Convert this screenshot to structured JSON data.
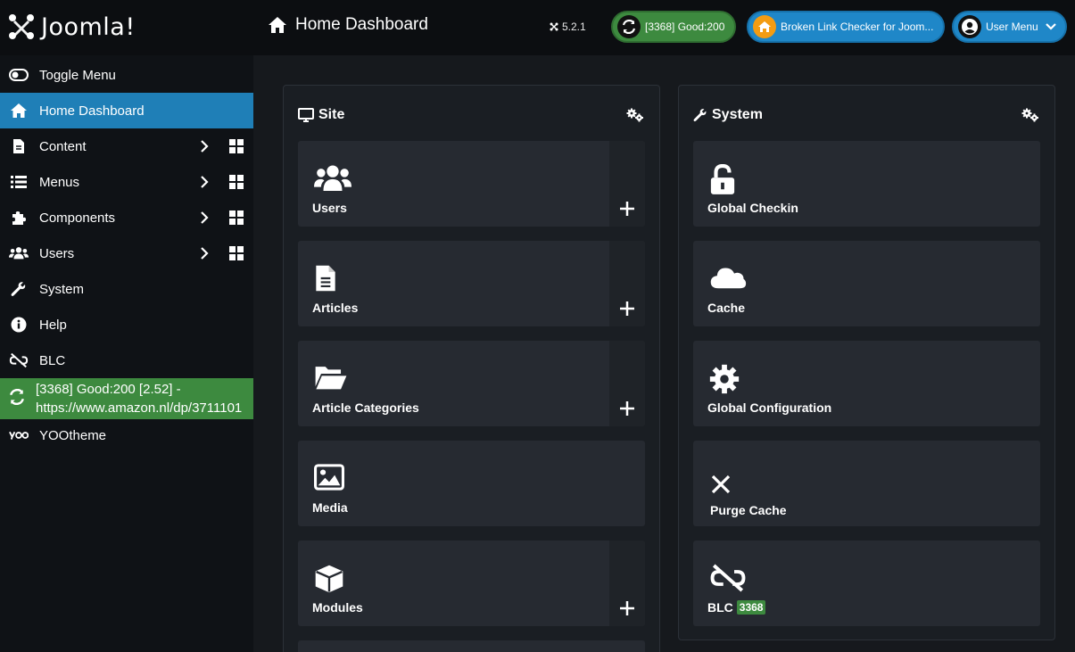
{
  "header": {
    "logo_text": "Joomla!",
    "page_title": "Home Dashboard",
    "version": "5.2.1",
    "blc_status_pill": "[3368] Good:200",
    "blc_plugin_pill": "Broken Link Checker for Joom...",
    "user_menu_label": "User Menu"
  },
  "sidebar": {
    "toggle_label": "Toggle Menu",
    "items": [
      {
        "label": "Home Dashboard",
        "icon": "home-icon",
        "active": true
      },
      {
        "label": "Content",
        "icon": "file-icon"
      },
      {
        "label": "Menus",
        "icon": "list-icon"
      },
      {
        "label": "Components",
        "icon": "puzzle-icon"
      },
      {
        "label": "Users",
        "icon": "users-icon"
      },
      {
        "label": "System",
        "icon": "wrench-icon"
      },
      {
        "label": "Help",
        "icon": "info-icon"
      },
      {
        "label": "BLC",
        "icon": "unlink-icon"
      }
    ],
    "blc_notice_line1": "[3368] Good:200 [2.52] -",
    "blc_notice_line2": "https://www.amazon.nl/dp/3711101",
    "yootheme_label": "YOOtheme"
  },
  "site_panel": {
    "title": "Site",
    "tiles": [
      {
        "label": "Users",
        "icon": "users-icon",
        "has_add": true
      },
      {
        "label": "Articles",
        "icon": "file-icon",
        "has_add": true
      },
      {
        "label": "Article Categories",
        "icon": "folder-open-icon",
        "has_add": true
      },
      {
        "label": "Media",
        "icon": "image-icon",
        "has_add": false
      },
      {
        "label": "Modules",
        "icon": "cube-icon",
        "has_add": true
      }
    ]
  },
  "system_panel": {
    "title": "System",
    "tiles": [
      {
        "label": "Global Checkin",
        "icon": "unlock-icon"
      },
      {
        "label": "Cache",
        "icon": "cloud-icon"
      },
      {
        "label": "Global Configuration",
        "icon": "gear-icon"
      },
      {
        "label": "Purge Cache",
        "icon": "close-icon"
      },
      {
        "label": "BLC",
        "icon": "unlink-icon",
        "badge": "3368"
      }
    ]
  },
  "colors": {
    "accent_blue": "#1f7fb7",
    "success_green": "#3d8a3f",
    "background": "#16191d",
    "tile": "#262a31"
  }
}
